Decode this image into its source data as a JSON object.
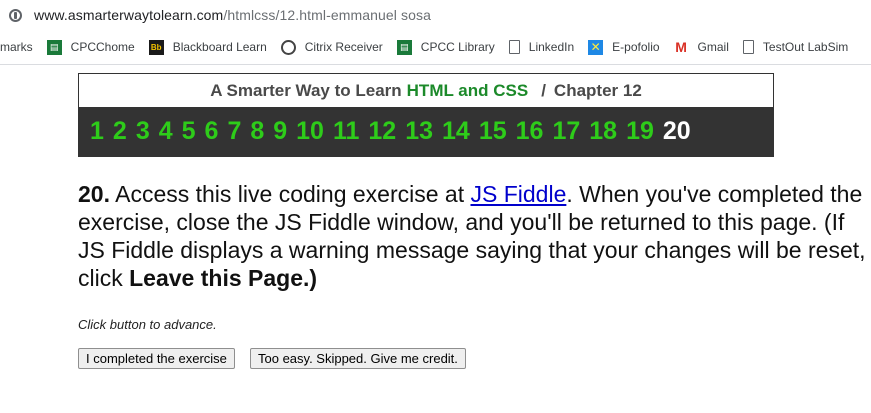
{
  "browser": {
    "url_host": "www.asmarterwaytolearn.com",
    "url_path": "/htmlcss/12.html-emmanuel sosa"
  },
  "bookmarks": [
    {
      "label": "marks",
      "icon": "none"
    },
    {
      "label": "CPCChome",
      "icon": "green-page-icon"
    },
    {
      "label": "Blackboard Learn",
      "icon": "bb-icon",
      "badge": "Bb"
    },
    {
      "label": "Citrix Receiver",
      "icon": "citrix-icon"
    },
    {
      "label": "CPCC Library",
      "icon": "green-page-icon"
    },
    {
      "label": "LinkedIn",
      "icon": "page-icon"
    },
    {
      "label": "E-pofolio",
      "icon": "x-icon"
    },
    {
      "label": "Gmail",
      "icon": "gmail-icon",
      "badge": "M"
    },
    {
      "label": "TestOut LabSim",
      "icon": "page-icon"
    }
  ],
  "chapter": {
    "prefix": "A Smarter Way to Learn",
    "accent": "HTML and CSS",
    "separator": "/",
    "label": "Chapter 12",
    "numbers": [
      "1",
      "2",
      "3",
      "4",
      "5",
      "6",
      "7",
      "8",
      "9",
      "10",
      "11",
      "12",
      "13",
      "14",
      "15",
      "16",
      "17",
      "18",
      "19",
      "20"
    ],
    "current": "20"
  },
  "exercise": {
    "number": "20.",
    "text_before_link": " Access this live coding exercise at ",
    "link_text": "JS Fiddle",
    "text_after_link": ". When you've completed the exercise, close the JS Fiddle window, and you'll be returned to this page. (If JS Fiddle displays a warning message saying that your changes will be reset, click ",
    "bold_end": "Leave this Page.)"
  },
  "advance_text": "Click button to advance.",
  "buttons": {
    "completed": "I completed the exercise",
    "skipped": "Too easy. Skipped. Give me credit."
  },
  "colors": {
    "accent_green": "#1c8a2a",
    "nav_number_green": "#2ecc1a",
    "nav_background": "#333333",
    "link_blue": "#0000cc"
  }
}
